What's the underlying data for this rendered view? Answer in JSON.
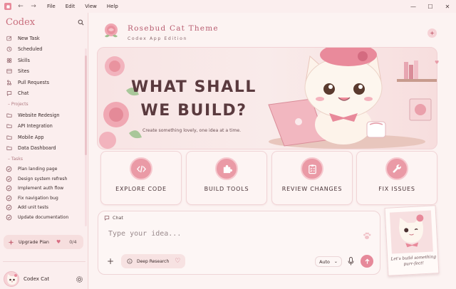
{
  "window": {
    "menus": [
      "File",
      "Edit",
      "View",
      "Help"
    ],
    "controls": {
      "minimize": "—",
      "maximize": "☐",
      "close": "✕"
    },
    "nav": {
      "back": "←",
      "forward": "→"
    }
  },
  "sidebar": {
    "brand": "Codex",
    "nav_items": [
      {
        "label": "New Task",
        "icon": "edit-icon"
      },
      {
        "label": "Scheduled",
        "icon": "clock-icon"
      },
      {
        "label": "Skills",
        "icon": "skills-icon"
      },
      {
        "label": "Sites",
        "icon": "globe-icon"
      },
      {
        "label": "Pull Requests",
        "icon": "pull-request-icon"
      },
      {
        "label": "Chat",
        "icon": "chat-icon"
      }
    ],
    "projects_title": "Projects",
    "projects": [
      "Website Redesign",
      "API Integration",
      "Mobile App",
      "Data Dashboard"
    ],
    "tasks_title": "Tasks",
    "tasks": [
      "Plan landing page",
      "Design system refresh",
      "Implement auth flow",
      "Fix navigation bug",
      "Add unit tests",
      "Update documentation"
    ],
    "upgrade": {
      "label": "Upgrade Plan",
      "count": "0/4"
    },
    "profile": {
      "name": "Codex Cat"
    }
  },
  "header": {
    "title": "Rosebud Cat Theme",
    "subtitle": "Codex App Edition"
  },
  "hero": {
    "title": "WHAT SHALL WE BUILD?",
    "subtitle": "Create something lovely, one idea at a time."
  },
  "cards": [
    {
      "label": "EXPLORE CODE",
      "icon": "code-icon"
    },
    {
      "label": "BUILD TOOLS",
      "icon": "puzzle-icon"
    },
    {
      "label": "REVIEW CHANGES",
      "icon": "clipboard-check-icon"
    },
    {
      "label": "FIX ISSUES",
      "icon": "wrench-icon"
    }
  ],
  "chat": {
    "label": "Chat",
    "placeholder": "Type your idea...",
    "deep_research": "Deep Research",
    "model": "Auto"
  },
  "polaroid": {
    "caption": "Let's build something purr-fect!"
  },
  "colors": {
    "accent": "#e6899a",
    "background": "#fbeeee",
    "brand": "#c96e7d"
  }
}
